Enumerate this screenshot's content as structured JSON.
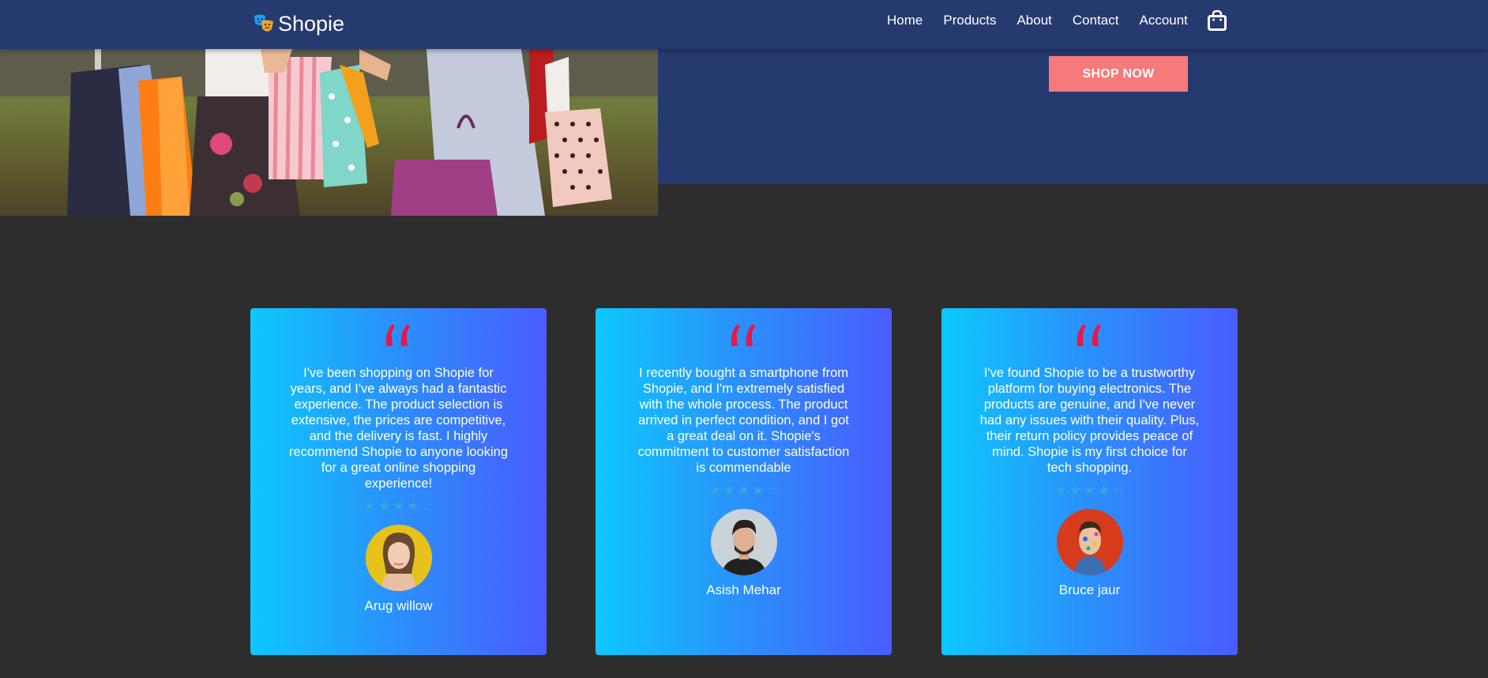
{
  "header": {
    "brand_name": "Shopie",
    "nav": [
      {
        "label": "Home"
      },
      {
        "label": "Products"
      },
      {
        "label": "About"
      },
      {
        "label": "Contact"
      },
      {
        "label": "Account"
      }
    ],
    "cart_icon": "shopping-bag-icon"
  },
  "hero": {
    "cta_label": "SHOP NOW",
    "image": "shopping-bags-photo"
  },
  "testimonials": [
    {
      "text": "I've been shopping on Shopie for years, and I've always had a fantastic experience. The product selection is extensive, the prices are competitive, and the delivery is fast. I highly recommend Shopie to anyone looking for a great online shopping experience!",
      "rating": 4,
      "name": "Arug willow"
    },
    {
      "text": "I recently bought a smartphone from Shopie, and I'm extremely satisfied with the whole process. The product arrived in perfect condition, and I got a great deal on it. Shopie's commitment to customer satisfaction is commendable",
      "rating": 4,
      "name": "Asish Mehar"
    },
    {
      "text": "I've found Shopie to be a trustworthy platform for buying electronics. The products are genuine, and I've never had any issues with their quality. Plus, their return policy provides peace of mind. Shopie is my first choice for tech shopping.",
      "rating": 4,
      "name": "Bruce jaur"
    }
  ],
  "colors": {
    "nav_bg": "#253a6e",
    "page_bg": "#2d2d2d",
    "cta_bg": "#f77a7a",
    "quote_mark": "#e8174a",
    "card_gradient_start": "#0dc8fc",
    "card_gradient_end": "#4a5cfe"
  }
}
